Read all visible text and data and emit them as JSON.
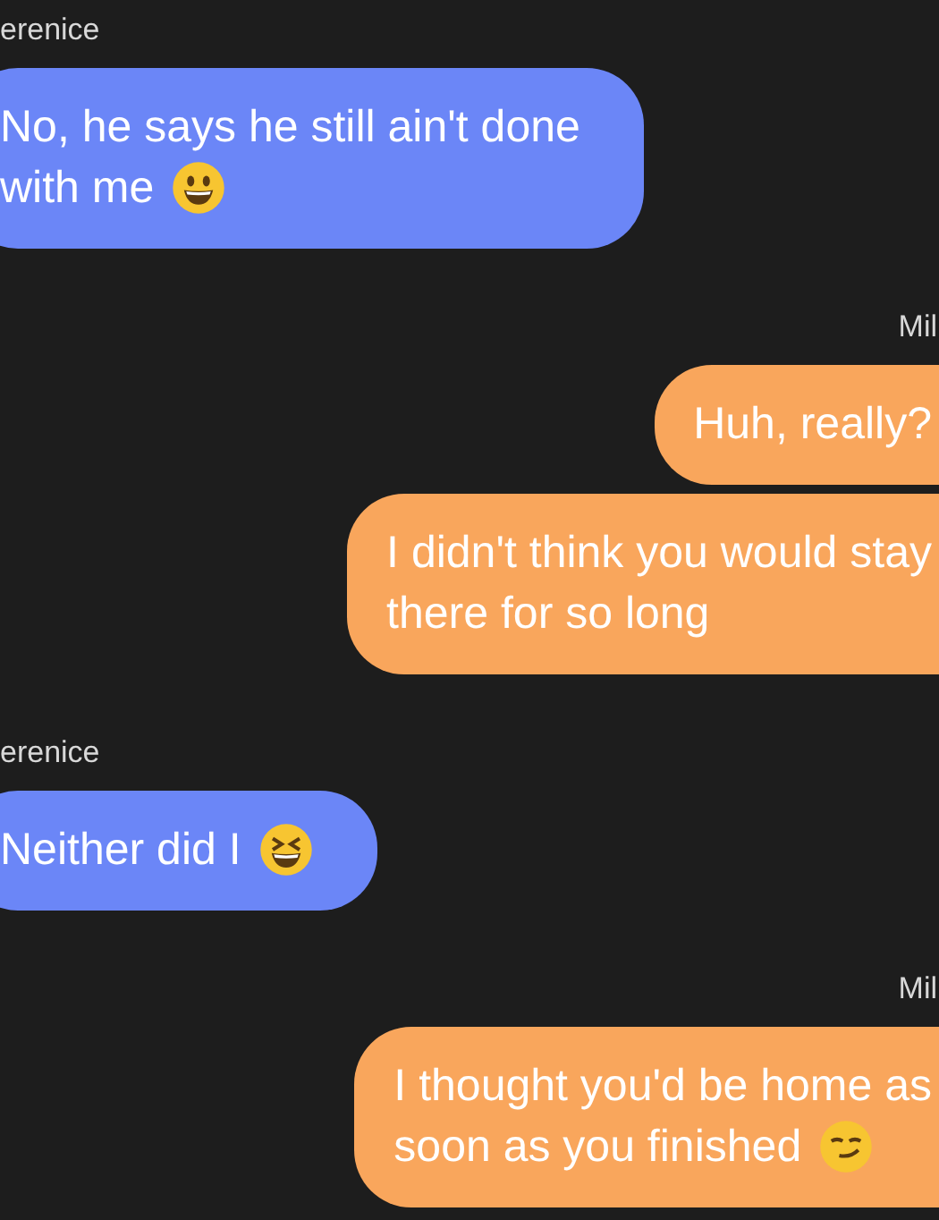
{
  "groups": [
    {
      "sender": "erenice",
      "kind": "incoming",
      "messages": [
        {
          "lines": [
            "No, he says he still ain't done",
            "with me"
          ],
          "icon": {
            "kind": "grinning"
          }
        }
      ]
    },
    {
      "sender": "Mil",
      "kind": "outgoing",
      "messages": [
        {
          "lines": [
            "Huh, really?"
          ]
        },
        {
          "lines": [
            "I didn't think you would stay",
            "there for so long"
          ]
        }
      ]
    },
    {
      "sender": "erenice",
      "kind": "incoming",
      "messages": [
        {
          "lines": [
            "Neither did I"
          ],
          "icon": {
            "kind": "laughing"
          }
        }
      ]
    },
    {
      "sender": "Mil",
      "kind": "outgoing",
      "messages": [
        {
          "lines": [
            "I thought you'd be home as",
            "soon as you finished"
          ],
          "icon": {
            "kind": "smirk"
          }
        }
      ]
    }
  ]
}
